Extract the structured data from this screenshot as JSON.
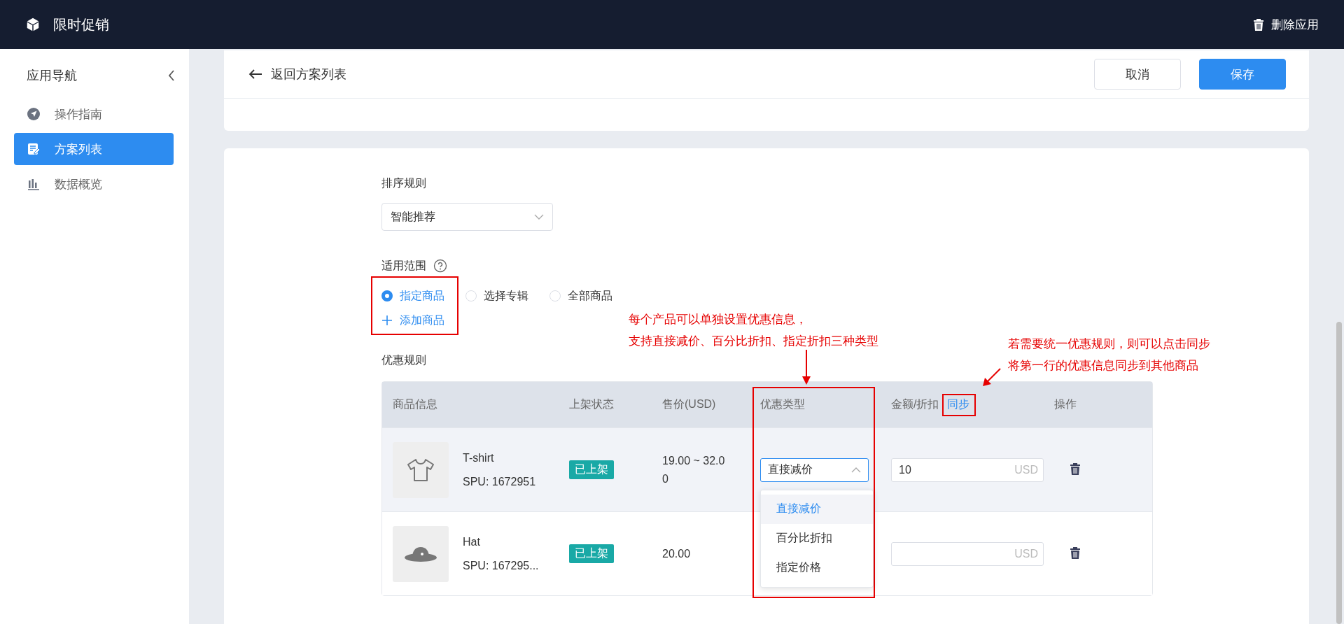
{
  "app": {
    "title": "限时促销",
    "action": "删除应用"
  },
  "sidebar": {
    "title": "应用导航",
    "items": [
      {
        "label": "操作指南",
        "selected": false
      },
      {
        "label": "方案列表",
        "selected": true
      },
      {
        "label": "数据概览",
        "selected": false
      }
    ]
  },
  "toolbar": {
    "back": "返回方案列表",
    "buttons": [
      {
        "label": "取消",
        "kind": "default"
      },
      {
        "label": "保存",
        "kind": "primary"
      }
    ]
  },
  "form": {
    "sort": {
      "label": "排序规则",
      "value": "智能推荐"
    },
    "scope": {
      "label": "适用范围",
      "options": [
        {
          "label": "指定商品",
          "selected": true
        },
        {
          "label": "选择专辑",
          "selected": false
        },
        {
          "label": "全部商品",
          "selected": false
        }
      ],
      "add": "添加商品"
    },
    "rules_label": "优惠规则"
  },
  "table": {
    "columns": [
      "商品信息",
      "上架状态",
      "售价(USD)",
      "优惠类型",
      "金额/折扣",
      "操作"
    ],
    "sync_link": "同步",
    "rows": [
      {
        "name": "T-shirt",
        "spu": "SPU: 1672951",
        "status": "已上架",
        "price": "19.00 ~ 32.00",
        "type": "直接减价",
        "type_open": true,
        "amount": "10",
        "unit": "USD",
        "highlighted": true
      },
      {
        "name": "Hat",
        "spu": "SPU: 167295...",
        "status": "已上架",
        "price": "20.00",
        "amount": "",
        "unit": "USD",
        "highlighted": false
      }
    ]
  },
  "dropdown": {
    "options": [
      {
        "label": "直接减价",
        "selected": true
      },
      {
        "label": "百分比折扣",
        "selected": false
      },
      {
        "label": "指定价格",
        "selected": false
      }
    ]
  },
  "annotations": [
    {
      "lines": [
        "每个产品可以单独设置优惠信息，",
        "支持直接减价、百分比折扣、指定折扣三种类型"
      ]
    },
    {
      "lines": [
        "若需要统一优惠规则，则可以点击同步",
        "将第一行的优惠信息同步到其他商品"
      ]
    }
  ]
}
